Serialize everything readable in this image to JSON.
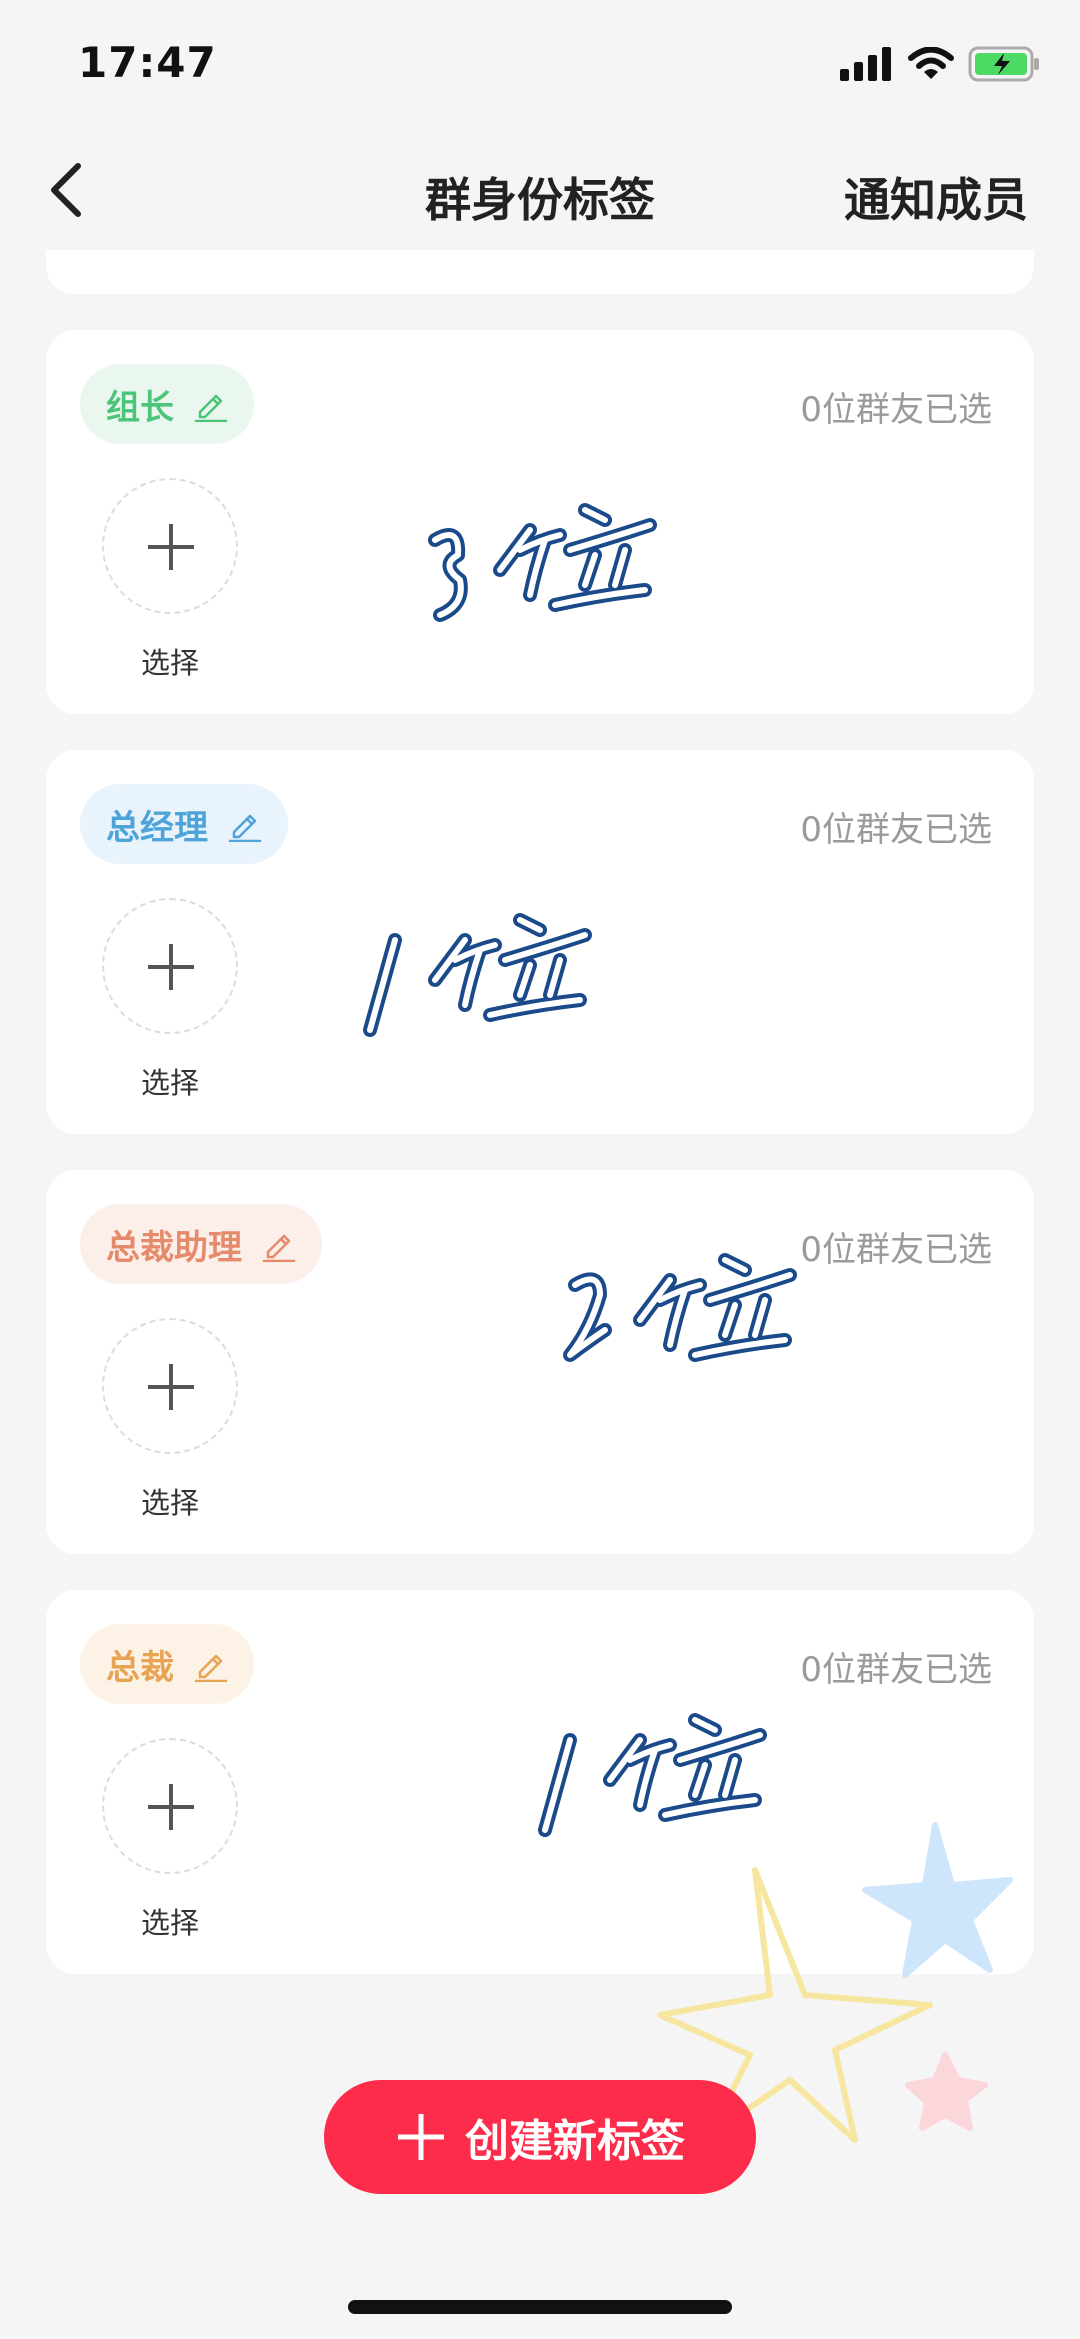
{
  "status_bar": {
    "time": "17:47"
  },
  "nav": {
    "title": "群身份标签",
    "right_action": "通知成员"
  },
  "tags": [
    {
      "name": "组长",
      "selected": "0位群友已选",
      "add_label": "选择",
      "pill_bg": "#eaf7ee",
      "color": "#4cc57a"
    },
    {
      "name": "总经理",
      "selected": "0位群友已选",
      "add_label": "选择",
      "pill_bg": "#e9f3fc",
      "color": "#4ea3d8"
    },
    {
      "name": "总裁助理",
      "selected": "0位群友已选",
      "add_label": "选择",
      "pill_bg": "#fcefea",
      "color": "#e58a6a"
    },
    {
      "name": "总裁",
      "selected": "0位群友已选",
      "add_label": "选择",
      "pill_bg": "#fcf2e6",
      "color": "#e8a353"
    }
  ],
  "create_button": {
    "label": "创建新标签",
    "color": "#fe2c4b"
  },
  "annotations": [
    {
      "handwritten": "3位"
    },
    {
      "handwritten": "1位"
    },
    {
      "handwritten": "2位"
    },
    {
      "handwritten": "1位"
    }
  ]
}
